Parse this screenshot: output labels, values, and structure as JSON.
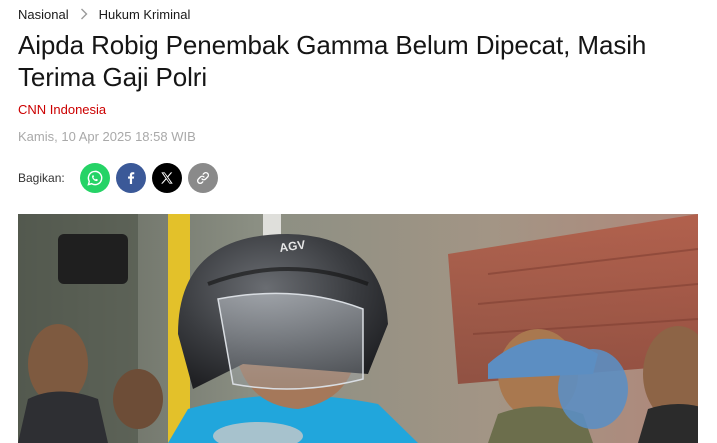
{
  "breadcrumb": {
    "items": [
      "Nasional",
      "Hukum Kriminal"
    ]
  },
  "article": {
    "title": "Aipda Robig Penembak Gamma Belum Dipecat, Masih Terima Gaji Polri",
    "source": "CNN Indonesia",
    "date": "Kamis, 10 Apr 2025 18:58 WIB"
  },
  "share": {
    "label": "Bagikan:",
    "buttons": [
      {
        "icon": "whatsapp-icon",
        "color": "#25d366"
      },
      {
        "icon": "facebook-icon",
        "color": "#3b5998"
      },
      {
        "icon": "x-icon",
        "color": "#000000"
      },
      {
        "icon": "link-icon",
        "color": "#8a8a8a"
      }
    ]
  },
  "hero": {
    "helmet_text": "AGV"
  },
  "colors": {
    "accent": "#cc0000",
    "muted": "#a9a9a9"
  }
}
